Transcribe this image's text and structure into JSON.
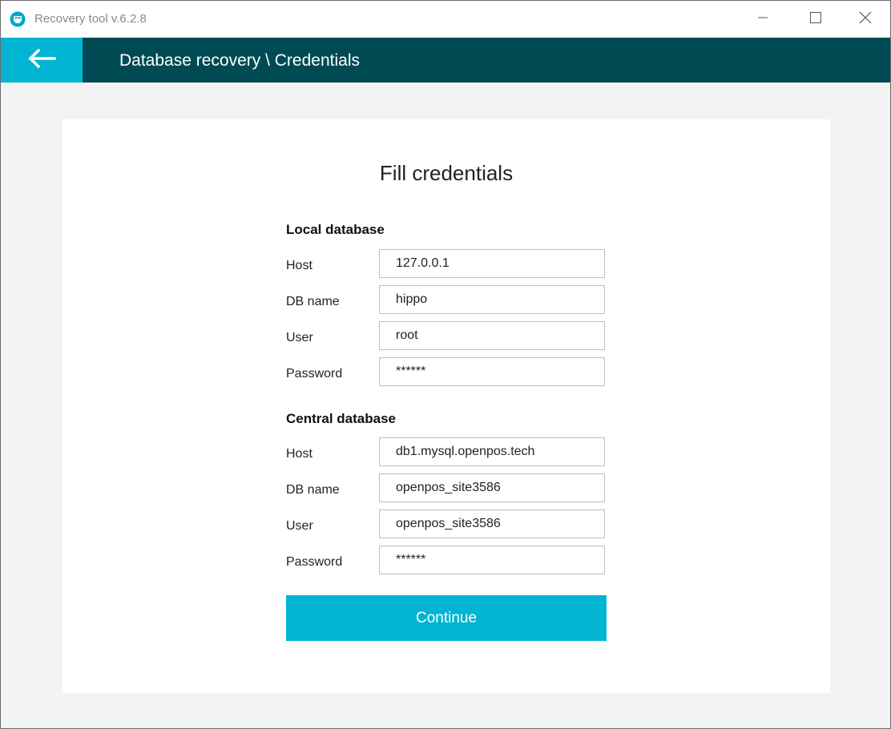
{
  "window": {
    "title": "Recovery tool v.6.2.8"
  },
  "header": {
    "breadcrumb": "Database recovery \\ Credentials"
  },
  "form": {
    "title": "Fill credentials",
    "local": {
      "heading": "Local database",
      "host_label": "Host",
      "host_value": "127.0.0.1",
      "dbname_label": "DB name",
      "dbname_value": "hippo",
      "user_label": "User",
      "user_value": "root",
      "password_label": "Password",
      "password_value": "******"
    },
    "central": {
      "heading": "Central database",
      "host_label": "Host",
      "host_value": "db1.mysql.openpos.tech",
      "dbname_label": "DB name",
      "dbname_value": "openpos_site3586",
      "user_label": "User",
      "user_value": "openpos_site3586",
      "password_label": "Password",
      "password_value": "******"
    },
    "continue_label": "Continue"
  },
  "colors": {
    "accent": "#00b4d2",
    "header_bg": "#004b53"
  },
  "icons": {
    "app": "app-logo-icon",
    "back": "arrow-left-icon",
    "minimize": "minimize-icon",
    "maximize": "maximize-icon",
    "close": "close-icon"
  }
}
